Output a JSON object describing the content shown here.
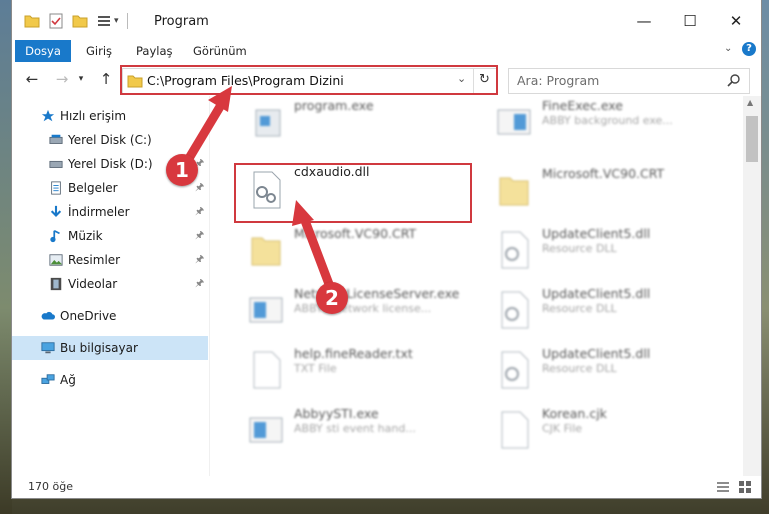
{
  "window": {
    "title": "Program"
  },
  "ribbon": {
    "tabs": [
      "Dosya",
      "Giriş",
      "Paylaş",
      "Görünüm"
    ]
  },
  "address": {
    "path": "C:\\Program Files\\Program Dizini"
  },
  "search": {
    "placeholder": "Ara: Program"
  },
  "sidebar": {
    "items": [
      {
        "label": "Hızlı erişim",
        "icon": "star-icon"
      },
      {
        "label": "Yerel Disk (C:)",
        "icon": "drive-icon"
      },
      {
        "label": "Yerel Disk (D:)",
        "icon": "drive-icon"
      },
      {
        "label": "Belgeler",
        "icon": "documents-icon"
      },
      {
        "label": "İndirmeler",
        "icon": "download-icon"
      },
      {
        "label": "Müzik",
        "icon": "music-icon"
      },
      {
        "label": "Resimler",
        "icon": "pictures-icon"
      },
      {
        "label": "Videolar",
        "icon": "videos-icon"
      },
      {
        "label": "OneDrive",
        "icon": "cloud-icon"
      },
      {
        "label": "Bu bilgisayar",
        "icon": "computer-icon"
      },
      {
        "label": "Ağ",
        "icon": "network-icon"
      }
    ]
  },
  "files": [
    {
      "name": "program.exe",
      "sub": ""
    },
    {
      "name": "FineExec.exe",
      "sub": "ABBY background exe..."
    },
    {
      "name": "cdxaudio.dll",
      "sub": ""
    },
    {
      "name": "Microsoft.VC90.CRT",
      "sub": ""
    },
    {
      "name": "Microsoft.VC90.CRT",
      "sub": ""
    },
    {
      "name": "UpdateClient5.dll",
      "sub": "Resource DLL"
    },
    {
      "name": "NetworkLicenseServer.exe",
      "sub": "ABBYY Network license..."
    },
    {
      "name": "UpdateClient5.dll",
      "sub": "Resource DLL"
    },
    {
      "name": "help.fineReader.txt",
      "sub": "TXT File"
    },
    {
      "name": "UpdateClient5.dll",
      "sub": "Resource DLL"
    },
    {
      "name": "AbbyySTI.exe",
      "sub": "ABBY sti event hand..."
    },
    {
      "name": "Korean.cjk",
      "sub": "CJK File"
    }
  ],
  "status": {
    "count": "170 öğe"
  },
  "annotations": {
    "step1": "1",
    "step2": "2"
  },
  "colors": {
    "accent": "#1979ca",
    "highlight": "#d0393f",
    "selected": "#cce4f7"
  }
}
